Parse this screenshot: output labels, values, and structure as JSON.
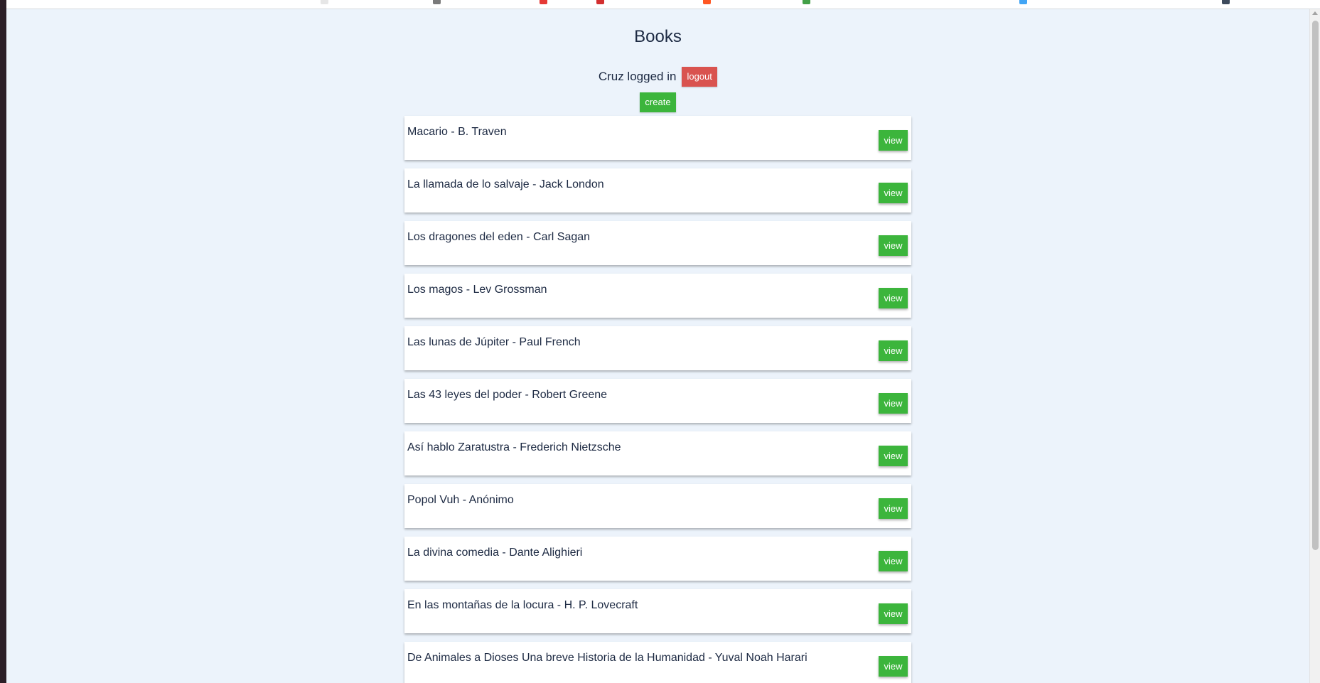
{
  "page": {
    "title": "Books"
  },
  "session": {
    "status_text": "Cruz logged in",
    "logout_label": "logout"
  },
  "actions": {
    "create_label": "create"
  },
  "books": [
    {
      "label": "Macario - B. Traven",
      "view_label": "view"
    },
    {
      "label": "La llamada de lo salvaje - Jack London",
      "view_label": "view"
    },
    {
      "label": "Los dragones del eden - Carl Sagan",
      "view_label": "view"
    },
    {
      "label": "Los magos - Lev Grossman",
      "view_label": "view"
    },
    {
      "label": "Las lunas de Júpiter - Paul French",
      "view_label": "view"
    },
    {
      "label": "Las 43 leyes del poder - Robert Greene",
      "view_label": "view"
    },
    {
      "label": "Así hablo Zaratustra - Frederich Nietzsche",
      "view_label": "view"
    },
    {
      "label": "Popol Vuh - Anónimo",
      "view_label": "view"
    },
    {
      "label": "La divina comedia - Dante Alighieri",
      "view_label": "view"
    },
    {
      "label": "En las montañas de la locura - H. P. Lovecraft",
      "view_label": "view"
    },
    {
      "label": "De Animales a Dioses Una breve Historia de la Humanidad - Yuval Noah Harari",
      "view_label": "view"
    }
  ],
  "colors": {
    "background": "#ecf3fb",
    "text": "#1c2942",
    "logout_button": "#d9534f",
    "primary_button": "#3cb53c"
  }
}
